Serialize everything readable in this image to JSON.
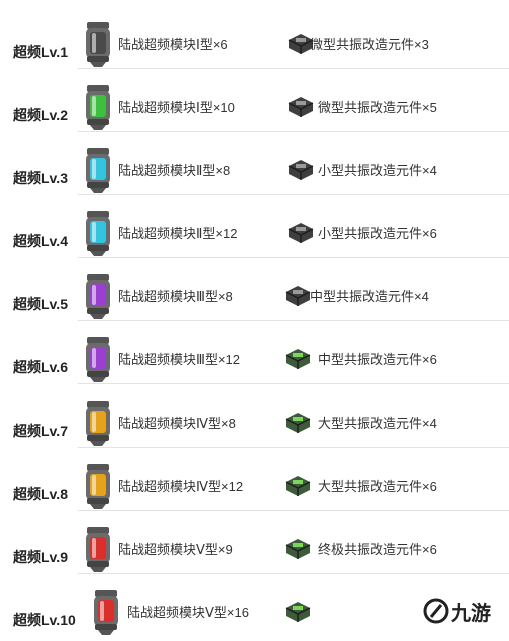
{
  "levels": [
    {
      "label": "超频Lv.1",
      "module": "陆战超频模块Ⅰ型×6",
      "component": "微型共振改造元件×3",
      "color": "#4a4a4a"
    },
    {
      "label": "超频Lv.2",
      "module": "陆战超频模块Ⅰ型×10",
      "component": "微型共振改造元件×5",
      "color": "#3fbf3f"
    },
    {
      "label": "超频Lv.3",
      "module": "陆战超频模块Ⅱ型×8",
      "component": "小型共振改造元件×4",
      "color": "#35c4e0"
    },
    {
      "label": "超频Lv.4",
      "module": "陆战超频模块Ⅱ型×12",
      "component": "小型共振改造元件×6",
      "color": "#35c4e0"
    },
    {
      "label": "超频Lv.5",
      "module": "陆战超频模块Ⅲ型×8",
      "component": "中型共振改造元件×4",
      "color": "#9b3fd0"
    },
    {
      "label": "超频Lv.6",
      "module": "陆战超频模块Ⅲ型×12",
      "component": "中型共振改造元件×6",
      "color": "#9b3fd0"
    },
    {
      "label": "超频Lv.7",
      "module": "陆战超频模块Ⅳ型×8",
      "component": "大型共振改造元件×4",
      "color": "#e5a21c"
    },
    {
      "label": "超频Lv.8",
      "module": "陆战超频模块Ⅳ型×12",
      "component": "大型共振改造元件×6",
      "color": "#e5a21c"
    },
    {
      "label": "超频Lv.9",
      "module": "陆战超频模块Ⅴ型×9",
      "component": "终极共振改造元件×6",
      "color": "#d9302c"
    },
    {
      "label": "超频Lv.10",
      "module": "陆战超频模块Ⅴ型×16",
      "component": "",
      "color": "#d9302c"
    }
  ],
  "watermark": {
    "text": "九游",
    "color": "#1a1a1a"
  }
}
